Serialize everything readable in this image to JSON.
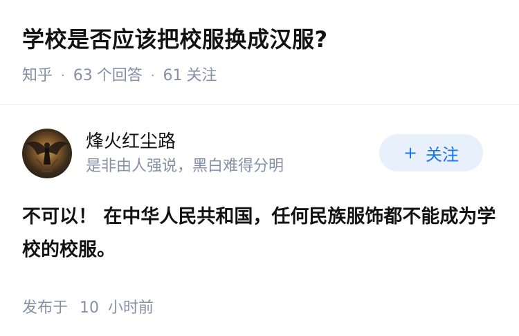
{
  "question": {
    "title": "学校是否应该把校服换成汉服?",
    "source": "知乎",
    "answer_count": "63",
    "answer_unit": "个回答",
    "follower_count": "61",
    "follower_unit": "关注",
    "separator": "·"
  },
  "answer": {
    "author_name": "烽火红尘路",
    "author_bio": "是非由人强说，黑白难得分明",
    "follow_label": "关注",
    "follow_plus": "+",
    "content": "不可以！ 在中华人民共和国，任何民族服饰都不能成为学校的校服。",
    "time_prefix": "发布于",
    "time_value": "10",
    "time_unit": "小时前"
  },
  "colors": {
    "title": "#121212",
    "meta": "#8590a6",
    "accent": "#1772f6",
    "follow_bg": "#e8f1fb"
  },
  "icons": {
    "avatar": "winged-figure-avatar",
    "follow": "plus-icon"
  }
}
